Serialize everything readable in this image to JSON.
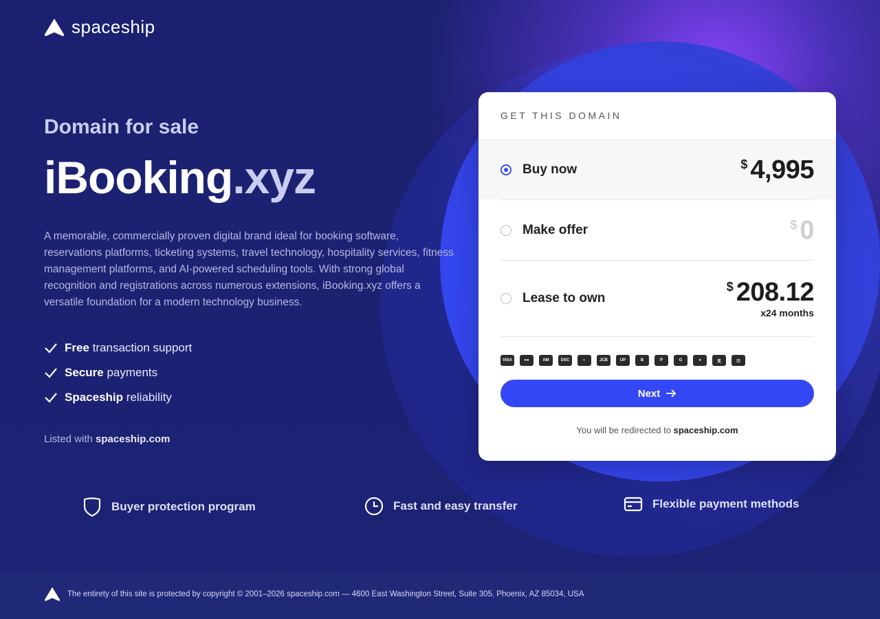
{
  "brand": {
    "name": "spaceship"
  },
  "hero": {
    "kicker": "Domain for sale",
    "domain_main": "iBooking",
    "domain_ext": ".xyz",
    "description": "A memorable, commercially proven digital brand ideal for booking software, reservations platforms, ticketing systems, travel technology, hospitality services, fitness management platforms, and AI-powered scheduling tools. With strong global recognition and registrations across numerous extensions, iBooking.xyz offers a versatile foundation for a modern technology business.",
    "features": [
      {
        "bold": "Free",
        "text": "transaction support"
      },
      {
        "bold": "Secure",
        "text": "payments"
      },
      {
        "bold": "Spaceship",
        "text": "reliability"
      }
    ],
    "listed_prefix": "Listed with",
    "listed_site": "spaceship.com"
  },
  "card": {
    "title": "GET THIS DOMAIN",
    "options": [
      {
        "label": "Buy now",
        "currency": "$",
        "amount": "4,995",
        "selected": true
      },
      {
        "label": "Make offer",
        "currency": "$",
        "amount": "0",
        "selected": false
      },
      {
        "label": "Lease to own",
        "currency": "$",
        "amount": "208.12",
        "sub": "x24 months",
        "selected": false
      }
    ],
    "payment_methods": [
      "VISA",
      "MC",
      "AMEX",
      "DISC",
      "DINERS",
      "JCB",
      "UNION",
      "BTC",
      "PP",
      "GPAY",
      "APAY",
      "ALI",
      "BANK"
    ],
    "next_label": "Next",
    "redirect_prefix": "You will be redirected to",
    "redirect_site": "spaceship.com"
  },
  "perks": [
    {
      "label": "Buyer protection program",
      "icon": "shield-icon"
    },
    {
      "label": "Fast and easy transfer",
      "icon": "clock-icon"
    },
    {
      "label": "Flexible payment methods",
      "icon": "credit-card-icon"
    }
  ],
  "footer": {
    "text": "The entirety of this site is protected by copyright © 2001–2026 spaceship.com — 4600 East Washington Street, Suite 305, Phoenix, AZ 85034, USA"
  },
  "colors": {
    "accent": "#3447f5",
    "background": "#1b2170"
  }
}
